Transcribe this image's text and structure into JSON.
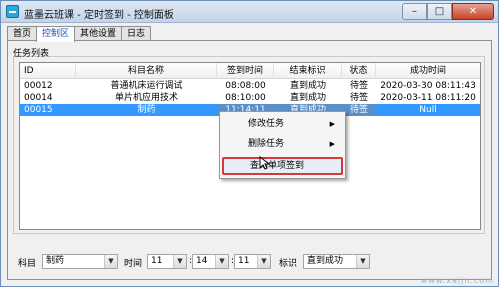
{
  "window": {
    "title": "蓝墨云班课 - 定时签到 - 控制面板",
    "buttons": {
      "minimize": "–",
      "maximize": "□",
      "close": "✕"
    }
  },
  "tabs": [
    {
      "label": "首页",
      "active": false
    },
    {
      "label": "控制区",
      "active": true
    },
    {
      "label": "其他设置",
      "active": false
    },
    {
      "label": "日志",
      "active": false
    }
  ],
  "task_group": {
    "label": "任务列表",
    "columns": [
      "ID",
      "科目名称",
      "签到时间",
      "结束标识",
      "状态",
      "成功时间"
    ],
    "rows": [
      {
        "id": "00012",
        "name": "普通机床运行调试",
        "time": "08:08:00",
        "end": "直到成功",
        "state": "待签",
        "done": "2020-03-30 08:11:43"
      },
      {
        "id": "00014",
        "name": "单片机应用技术",
        "time": "08:10:00",
        "end": "直到成功",
        "state": "待签",
        "done": "2020-03-11 08:11:20"
      },
      {
        "id": "00015",
        "name": "制药",
        "time": "11:14:11",
        "end": "直到成功",
        "state": "待签",
        "done": "Null",
        "selected": true
      }
    ]
  },
  "context_menu": {
    "items": [
      {
        "label": "修改任务",
        "submenu": true
      },
      {
        "label": "删除任务",
        "submenu": true
      },
      {
        "label": "查询单项签到",
        "submenu": false,
        "highlighted": true
      }
    ]
  },
  "form": {
    "subject_label": "科目",
    "subject_value": "制药",
    "time_label": "时间",
    "hour": "11",
    "minute": "14",
    "second": "11",
    "flag_label": "标识",
    "flag_value": "直到成功"
  },
  "watermark": "www.xajjn.com",
  "colors": {
    "selection": "#3399ff",
    "highlight_border": "#d9383a",
    "active_tab_text": "#1a4fb4"
  }
}
